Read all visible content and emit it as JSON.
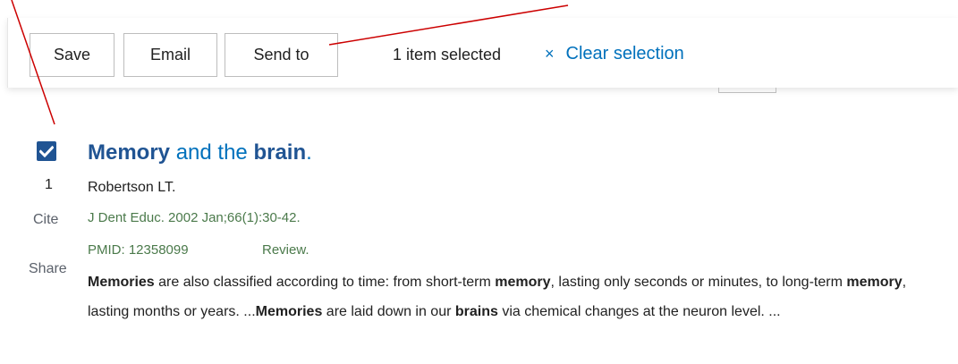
{
  "toolbar": {
    "save_label": "Save",
    "email_label": "Email",
    "send_to_label": "Send to",
    "selected_text": "1 item selected",
    "clear_icon": "×",
    "clear_label": "Clear selection"
  },
  "result": {
    "checked": true,
    "number": "1",
    "cite_label": "Cite",
    "share_label": "Share",
    "title_parts": [
      "Memory",
      " and the ",
      "brain",
      "."
    ],
    "authors": "Robertson LT.",
    "citation": "J Dent Educ. 2002 Jan;66(1):30-42.",
    "pmid": "PMID: 12358099",
    "publication_type": "Review.",
    "snippet_parts": [
      "Memories",
      " are also classified according to time: from short-term ",
      "memory",
      ", lasting only seconds or minutes, to long-term ",
      "memory",
      ", lasting months or years. ...",
      "Memories",
      " are laid down in our ",
      "brains",
      " via chemical changes at the neuron level. ..."
    ]
  },
  "colors": {
    "link": "#0071bc",
    "checkbox": "#205493",
    "annotation_line": "#cc0000"
  }
}
